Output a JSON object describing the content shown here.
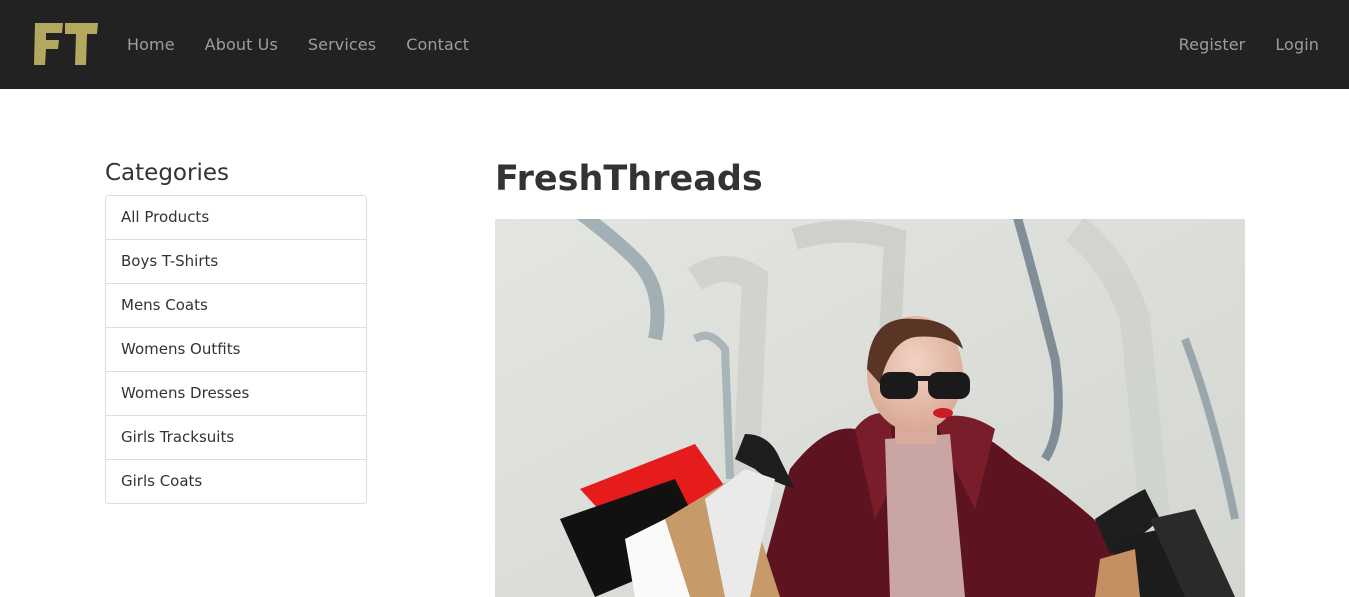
{
  "navbar": {
    "brand": {
      "logo_text": "FT",
      "logo_color": "#b3a95e"
    },
    "left_links": [
      {
        "label": "Home"
      },
      {
        "label": "About Us"
      },
      {
        "label": "Services"
      },
      {
        "label": "Contact"
      }
    ],
    "right_links": [
      {
        "label": "Register"
      },
      {
        "label": "Login"
      }
    ],
    "background": "#222222",
    "link_color": "#9d9d9d"
  },
  "sidebar": {
    "heading": "Categories",
    "items": [
      {
        "label": "All Products"
      },
      {
        "label": "Boys T-Shirts"
      },
      {
        "label": "Mens Coats"
      },
      {
        "label": "Womens Outfits"
      },
      {
        "label": "Womens Dresses"
      },
      {
        "label": "Girls Tracksuits"
      },
      {
        "label": "Girls Coats"
      }
    ]
  },
  "main": {
    "title": "FreshThreads",
    "hero_image": {
      "subject": "woman-with-shopping-bags"
    }
  }
}
